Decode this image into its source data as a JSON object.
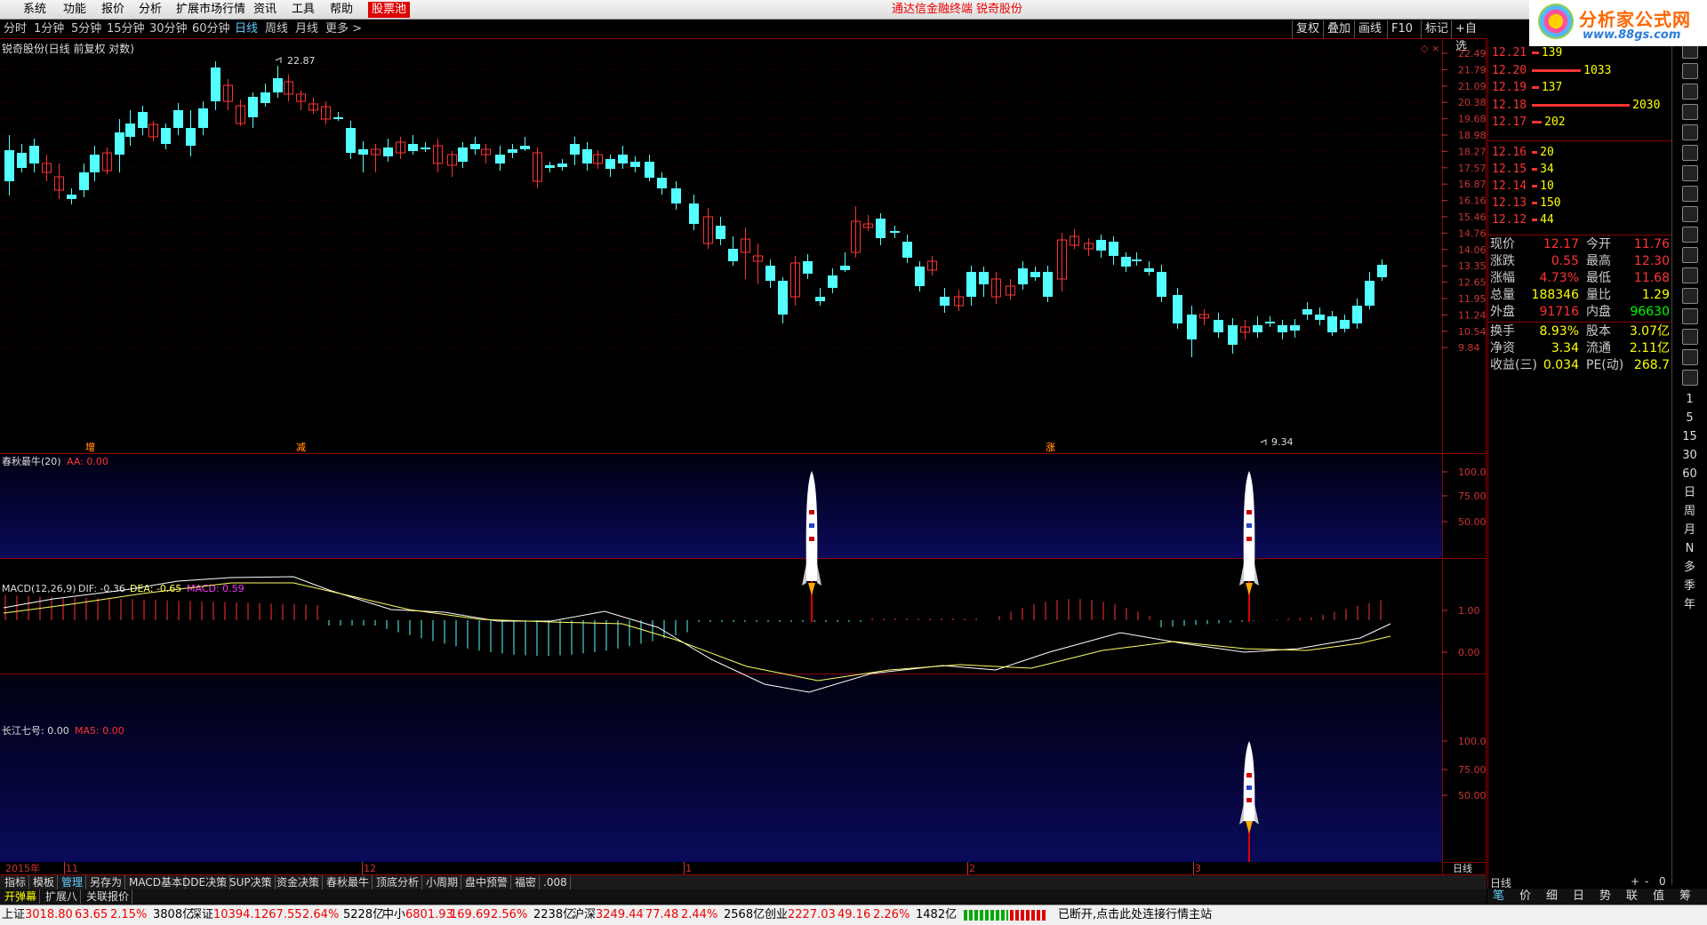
{
  "menu": {
    "items": [
      "系统",
      "功能",
      "报价",
      "分析",
      "扩展市场行情",
      "资讯",
      "工具",
      "帮助"
    ],
    "pool_label": "股票池",
    "terminal_name": "通达信金融终端",
    "stock_title": "锐奇股份",
    "logo_text": "分析家公式网",
    "logo_url": "www.88gs.com"
  },
  "periods": [
    "分时",
    "1分钟",
    "5分钟",
    "15分钟",
    "30分钟",
    "60分钟",
    "日线",
    "周线",
    "月线",
    "更多 >"
  ],
  "active_period": "日线",
  "toolbar_right": [
    "复权",
    "叠加",
    "画线",
    "F10",
    "标记",
    "+自选"
  ],
  "chart": {
    "title": "锐奇股份(日线 前复权 对数)",
    "high_label": "22.87",
    "low_label": "9.34",
    "price_axis": [
      "22.49",
      "21.79",
      "21.09",
      "20.38",
      "19.68",
      "18.98",
      "18.27",
      "17.57",
      "16.87",
      "16.16",
      "15.46",
      "14.76",
      "14.06",
      "13.35",
      "12.65",
      "11.95",
      "11.24",
      "10.54",
      "9.84"
    ],
    "markers": [
      "增",
      "减",
      "涨"
    ],
    "date_labels": [
      "2015年",
      "11",
      "12",
      "1",
      "2",
      "3"
    ],
    "period_label": "日线"
  },
  "indicator1": {
    "name": "春秋最牛(20)",
    "aa_label": "AA: 0.00",
    "axis": [
      "100.0",
      "75.00",
      "50.00"
    ]
  },
  "macd": {
    "name": "MACD(12,26,9)",
    "dif": "DIF: -0.36",
    "dea": "DEA: -0.65",
    "macd": "MACD: 0.59",
    "axis": [
      "1.00",
      "0.00"
    ]
  },
  "indicator3": {
    "name": "长江七号: 0.00",
    "ma5": "MA5: 0.00",
    "axis": [
      "100.0",
      "75.00",
      "50.00"
    ]
  },
  "orderbook": {
    "sell": [
      {
        "price": "12.21",
        "vol": "139",
        "bar": 0.07
      },
      {
        "price": "12.20",
        "vol": "1033",
        "bar": 0.5
      },
      {
        "price": "12.19",
        "vol": "137",
        "bar": 0.07
      },
      {
        "price": "12.18",
        "vol": "2030",
        "bar": 1.0
      },
      {
        "price": "12.17",
        "vol": "202",
        "bar": 0.1
      }
    ],
    "buy": [
      {
        "price": "12.16",
        "vol": "20"
      },
      {
        "price": "12.15",
        "vol": "34"
      },
      {
        "price": "12.14",
        "vol": "10"
      },
      {
        "price": "12.13",
        "vol": "150"
      },
      {
        "price": "12.12",
        "vol": "44"
      }
    ]
  },
  "quote": [
    {
      "l1": "现价",
      "v1": "12.17",
      "c1": "#f33",
      "l2": "今开",
      "v2": "11.76",
      "c2": "#f33"
    },
    {
      "l1": "涨跌",
      "v1": "0.55",
      "c1": "#f33",
      "l2": "最高",
      "v2": "12.30",
      "c2": "#f33"
    },
    {
      "l1": "涨幅",
      "v1": "4.73%",
      "c1": "#f33",
      "l2": "最低",
      "v2": "11.68",
      "c2": "#f33"
    },
    {
      "l1": "总量",
      "v1": "188346",
      "c1": "#ff0",
      "l2": "量比",
      "v2": "1.29",
      "c2": "#ff0"
    },
    {
      "l1": "外盘",
      "v1": "91716",
      "c1": "#f33",
      "l2": "内盘",
      "v2": "96630",
      "c2": "#0f0"
    },
    {
      "l1": "换手",
      "v1": "8.93%",
      "c1": "#ff0",
      "l2": "股本",
      "v2": "3.07亿",
      "c2": "#ff0"
    },
    {
      "l1": "净资",
      "v1": "3.34",
      "c1": "#ff0",
      "l2": "流通",
      "v2": "2.11亿",
      "c2": "#ff0"
    },
    {
      "l1": "收益(三)",
      "v1": "0.034",
      "c1": "#ff0",
      "l2": "PE(动)",
      "v2": "268.7",
      "c2": "#ff0"
    }
  ],
  "icon_texts": [
    "1",
    "5",
    "15",
    "30",
    "60",
    "日",
    "周",
    "月",
    "N",
    "多",
    "季",
    "年"
  ],
  "tabs1": [
    "指标",
    "模板",
    "管理",
    "另存为",
    "MACD基本",
    "DDE决策",
    "SUP决策",
    "资金决策",
    "春秋最牛",
    "顶底分析",
    "小周期",
    "盘中预警",
    "福密",
    ".008"
  ],
  "active_tab": "管理",
  "tabs2": [
    "开弹幕",
    "扩展八",
    "关联报价"
  ],
  "right_bottom": {
    "label": "日线",
    "controls": [
      "+",
      "-",
      "0"
    ]
  },
  "right_tabs": [
    "笔",
    "价",
    "细",
    "日",
    "势",
    "联",
    "值",
    "筹"
  ],
  "status": {
    "sh": {
      "name": "上证",
      "price": "3018.80",
      "chg": "63.65",
      "pct": "2.15%",
      "amt": "3808亿"
    },
    "sz": {
      "name": "深证",
      "price": "10394.1",
      "chg": "267.55",
      "pct": "2.64%",
      "amt": "5228亿"
    },
    "zx": {
      "name": "中小",
      "price": "6801.93",
      "chg": "169.69",
      "pct": "2.56%",
      "amt": "2238亿"
    },
    "hs": {
      "name": "沪深",
      "price": "3249.44",
      "chg": "77.48",
      "pct": "2.44%",
      "amt": "2568亿"
    },
    "cy": {
      "name": "创业",
      "price": "2227.03",
      "chg": "49.16",
      "pct": "2.26%",
      "amt": "1482亿"
    },
    "msg": "已断开,点击此处连接行情主站"
  },
  "colors": {
    "up": "#ff3333",
    "down": "#54ffff",
    "frame": "#880000",
    "ma": "#ffffff",
    "dea": "#ffff66",
    "panel_bg_top": "#000000",
    "panel_bg_bottom": "#0a0a5a"
  }
}
